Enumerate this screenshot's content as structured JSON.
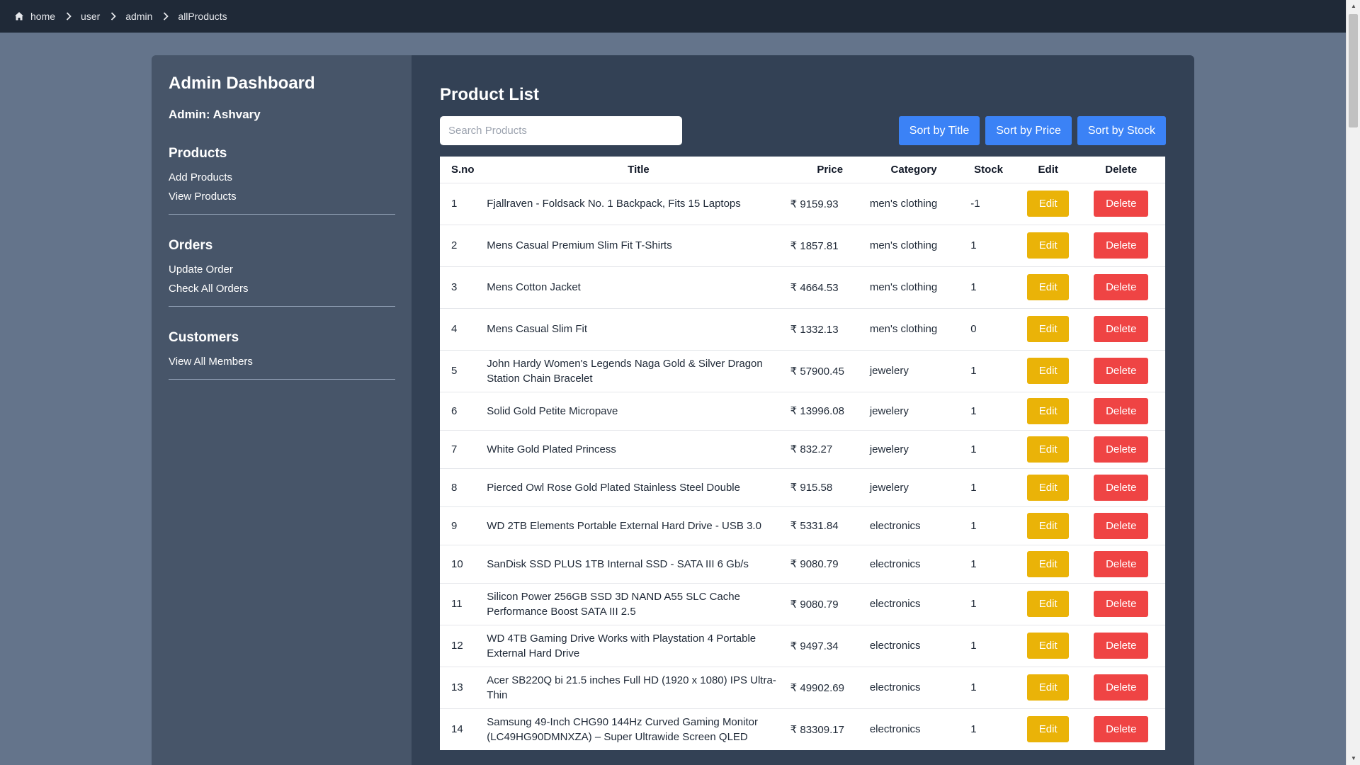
{
  "breadcrumb": [
    "home",
    "user",
    "admin",
    "allProducts"
  ],
  "sidebar": {
    "title": "Admin Dashboard",
    "admin_label": "Admin: Ashvary",
    "sections": [
      {
        "title": "Products",
        "links": [
          "Add Products",
          "View Products"
        ]
      },
      {
        "title": "Orders",
        "links": [
          "Update Order",
          "Check All Orders"
        ]
      },
      {
        "title": "Customers",
        "links": [
          "View All Members"
        ]
      }
    ]
  },
  "main": {
    "title": "Product List",
    "search_placeholder": "Search Products",
    "sort_buttons": [
      "Sort by Title",
      "Sort by Price",
      "Sort by Stock"
    ],
    "columns": [
      "S.no",
      "Title",
      "Price",
      "Category",
      "Stock",
      "Edit",
      "Delete"
    ],
    "edit_label": "Edit",
    "delete_label": "Delete",
    "rows": [
      {
        "sno": "1",
        "title": "Fjallraven - Foldsack No. 1 Backpack, Fits 15 Laptops",
        "price": "₹ 9159.93",
        "category": "men's clothing",
        "stock": "-1"
      },
      {
        "sno": "2",
        "title": "Mens Casual Premium Slim Fit T-Shirts",
        "price": "₹ 1857.81",
        "category": "men's clothing",
        "stock": "1"
      },
      {
        "sno": "3",
        "title": "Mens Cotton Jacket",
        "price": "₹ 4664.53",
        "category": "men's clothing",
        "stock": "1"
      },
      {
        "sno": "4",
        "title": "Mens Casual Slim Fit",
        "price": "₹ 1332.13",
        "category": "men's clothing",
        "stock": "0"
      },
      {
        "sno": "5",
        "title": "John Hardy Women's Legends Naga Gold & Silver Dragon Station Chain Bracelet",
        "price": "₹ 57900.45",
        "category": "jewelery",
        "stock": "1"
      },
      {
        "sno": "6",
        "title": "Solid Gold Petite Micropave",
        "price": "₹ 13996.08",
        "category": "jewelery",
        "stock": "1"
      },
      {
        "sno": "7",
        "title": "White Gold Plated Princess",
        "price": "₹ 832.27",
        "category": "jewelery",
        "stock": "1"
      },
      {
        "sno": "8",
        "title": "Pierced Owl Rose Gold Plated Stainless Steel Double",
        "price": "₹ 915.58",
        "category": "jewelery",
        "stock": "1"
      },
      {
        "sno": "9",
        "title": "WD 2TB Elements Portable External Hard Drive - USB 3.0",
        "price": "₹ 5331.84",
        "category": "electronics",
        "stock": "1"
      },
      {
        "sno": "10",
        "title": "SanDisk SSD PLUS 1TB Internal SSD - SATA III 6 Gb/s",
        "price": "₹ 9080.79",
        "category": "electronics",
        "stock": "1"
      },
      {
        "sno": "11",
        "title": "Silicon Power 256GB SSD 3D NAND A55 SLC Cache Performance Boost SATA III 2.5",
        "price": "₹ 9080.79",
        "category": "electronics",
        "stock": "1"
      },
      {
        "sno": "12",
        "title": "WD 4TB Gaming Drive Works with Playstation 4 Portable External Hard Drive",
        "price": "₹ 9497.34",
        "category": "electronics",
        "stock": "1"
      },
      {
        "sno": "13",
        "title": "Acer SB220Q bi 21.5 inches Full HD (1920 x 1080) IPS Ultra-Thin",
        "price": "₹ 49902.69",
        "category": "electronics",
        "stock": "1"
      },
      {
        "sno": "14",
        "title": "Samsung 49-Inch CHG90 144Hz Curved Gaming Monitor (LC49HG90DMNXZA) – Super Ultrawide Screen QLED",
        "price": "₹ 83309.17",
        "category": "electronics",
        "stock": "1"
      }
    ]
  },
  "colors": {
    "page_bg": "#64748b",
    "topbar": "#1f2937",
    "sidebar": "#475569",
    "main": "#334155",
    "sort_button": "#3b82f6",
    "edit_button": "#eab308",
    "delete_button": "#ef4444"
  }
}
